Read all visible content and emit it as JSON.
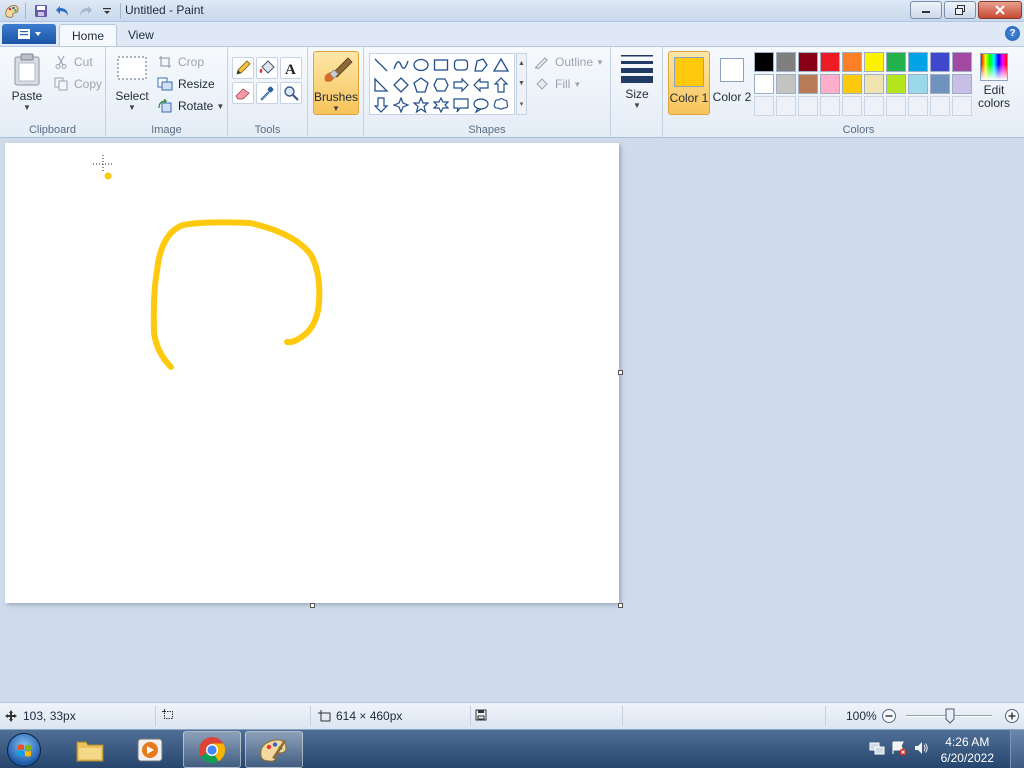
{
  "window": {
    "title": "Untitled - Paint",
    "app_icon": "paint-icon",
    "quick_access": [
      "save-icon",
      "undo-icon",
      "redo-icon",
      "customize-icon"
    ]
  },
  "ribbon_tabs": {
    "home": "Home",
    "view": "View"
  },
  "clipboard": {
    "group_label": "Clipboard",
    "paste": "Paste",
    "cut": "Cut",
    "copy": "Copy"
  },
  "image": {
    "group_label": "Image",
    "select": "Select",
    "crop": "Crop",
    "resize": "Resize",
    "rotate": "Rotate"
  },
  "tools": {
    "group_label": "Tools",
    "items": [
      "pencil-icon",
      "fill-icon",
      "text-icon",
      "eraser-icon",
      "color-picker-icon",
      "magnifier-icon"
    ]
  },
  "brushes": {
    "label": "Brushes"
  },
  "shapes": {
    "group_label": "Shapes",
    "outline": "Outline",
    "fill": "Fill"
  },
  "size": {
    "label": "Size"
  },
  "colors": {
    "group_label": "Colors",
    "color1_label": "Color 1",
    "color2_label": "Color 2",
    "color1_value": "#ffc90e",
    "color2_value": "#ffffff",
    "edit_label": "Edit colors",
    "palette_row1": [
      "#000000",
      "#7f7f7f",
      "#880015",
      "#ed1c24",
      "#ff7f27",
      "#fff200",
      "#22b14c",
      "#00a2e8",
      "#3f48cc",
      "#a349a4"
    ],
    "palette_row2": [
      "#ffffff",
      "#c3c3c3",
      "#b97a57",
      "#ffaec9",
      "#ffc90e",
      "#efe4b0",
      "#b5e61d",
      "#99d9ea",
      "#7092be",
      "#c8bfe7"
    ]
  },
  "canvas": {
    "stroke_color": "#ffc90e"
  },
  "status": {
    "cursor_pos": "103, 33px",
    "canvas_size": "614 × 460px",
    "zoom": "100%"
  },
  "taskbar": {
    "apps": [
      "explorer-icon",
      "media-player-icon",
      "chrome-icon",
      "paint-icon"
    ],
    "time": "4:26 AM",
    "date": "6/20/2022"
  }
}
